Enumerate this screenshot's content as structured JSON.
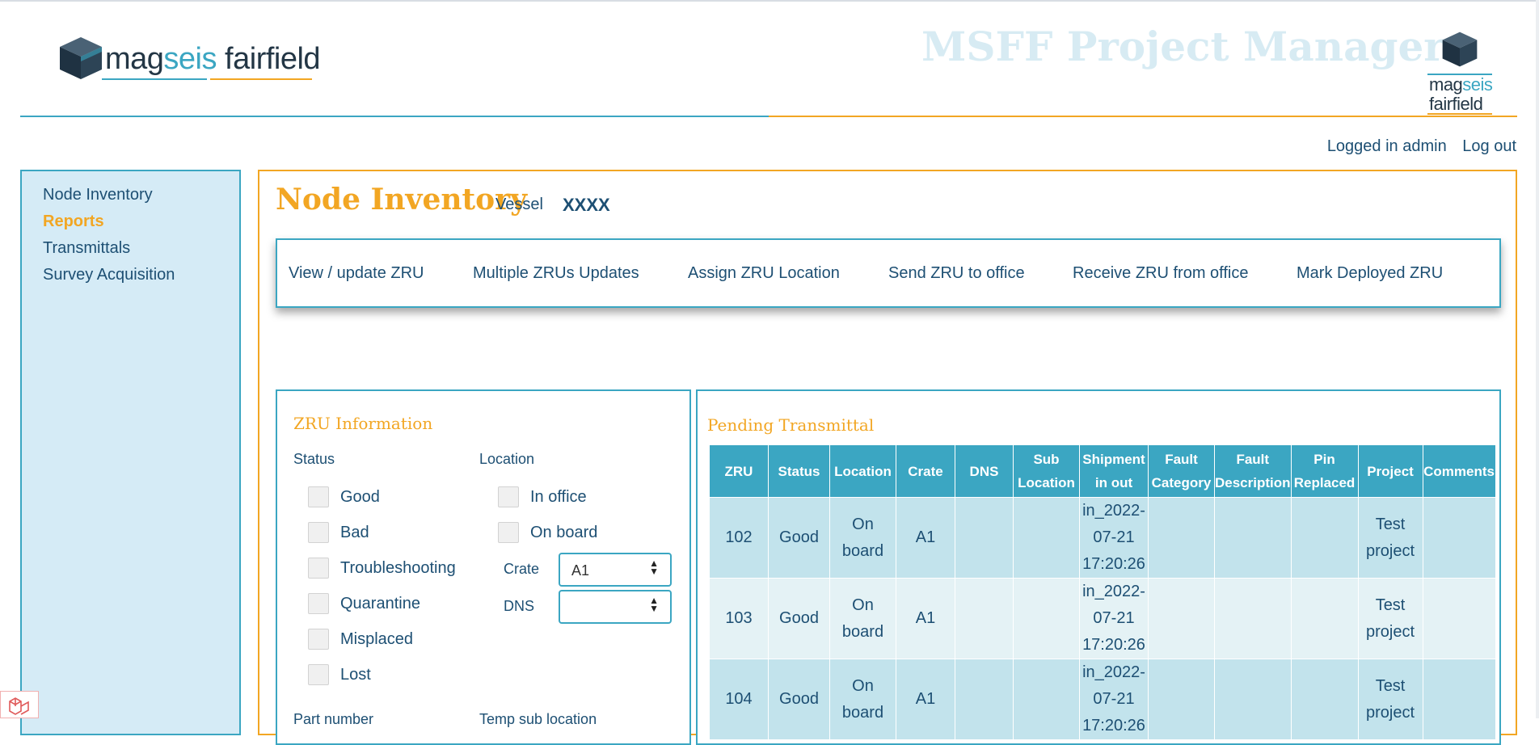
{
  "header": {
    "brand_left": {
      "mag": "mag",
      "seis": "seis",
      "fairfield": " fairfield"
    },
    "app_title": "MSFF Project Manager",
    "brand_right": {
      "mag": "mag",
      "seis": "seis",
      "fairfield": "fairfield"
    }
  },
  "auth": {
    "logged_in": "Logged in admin",
    "logout": "Log out"
  },
  "sidebar": {
    "items": [
      {
        "label": "Node Inventory",
        "active": false
      },
      {
        "label": "Reports",
        "active": true
      },
      {
        "label": "Transmittals",
        "active": false
      },
      {
        "label": "Survey Acquisition",
        "active": false
      }
    ]
  },
  "main": {
    "title": "Node Inventory",
    "vessel_label": "Vessel",
    "vessel_value": "XXXX",
    "actions": [
      "View / update ZRU",
      "Multiple ZRUs Updates",
      "Assign ZRU Location",
      "Send ZRU to office",
      "Receive ZRU from office",
      "Mark Deployed ZRU"
    ]
  },
  "zru_info": {
    "title": "ZRU Information",
    "status_label": "Status",
    "status_options": [
      "Good",
      "Bad",
      "Troubleshooting",
      "Quarantine",
      "Misplaced",
      "Lost"
    ],
    "location_label": "Location",
    "location_options": [
      "In office",
      "On board"
    ],
    "crate_label": "Crate",
    "crate_value": "A1",
    "dns_label": "DNS",
    "dns_value": "",
    "part_number_label": "Part number",
    "temp_sub_location_label": "Temp sub location"
  },
  "pending": {
    "title": "Pending Transmittal",
    "columns": [
      [
        "ZRU"
      ],
      [
        "Status"
      ],
      [
        "Location"
      ],
      [
        "Crate"
      ],
      [
        "DNS"
      ],
      [
        "Sub",
        "Location"
      ],
      [
        "Shipment",
        "in out"
      ],
      [
        "Fault",
        "Category"
      ],
      [
        "Fault",
        "Description"
      ],
      [
        "Pin",
        "Replaced"
      ],
      [
        "Project"
      ],
      [
        "Comments"
      ]
    ],
    "rows": [
      {
        "zru": "102",
        "status": "Good",
        "location": [
          "On",
          "board"
        ],
        "crate": "A1",
        "dns": "",
        "sub_location": "",
        "shipment": [
          "in_2022-",
          "07-21",
          "17:20:26"
        ],
        "fault_category": "",
        "fault_description": "",
        "pin_replaced": "",
        "project": [
          "Test",
          "project"
        ],
        "comments": ""
      },
      {
        "zru": "103",
        "status": "Good",
        "location": [
          "On",
          "board"
        ],
        "crate": "A1",
        "dns": "",
        "sub_location": "",
        "shipment": [
          "in_2022-",
          "07-21",
          "17:20:26"
        ],
        "fault_category": "",
        "fault_description": "",
        "pin_replaced": "",
        "project": [
          "Test",
          "project"
        ],
        "comments": ""
      },
      {
        "zru": "104",
        "status": "Good",
        "location": [
          "On",
          "board"
        ],
        "crate": "A1",
        "dns": "",
        "sub_location": "",
        "shipment": [
          "in_2022-",
          "07-21",
          "17:20:26"
        ],
        "fault_category": "",
        "fault_description": "",
        "pin_replaced": "",
        "project": [
          "Test",
          "project"
        ],
        "comments": ""
      }
    ]
  },
  "colors": {
    "accent_blue": "#3ba6c2",
    "accent_orange": "#f2a623",
    "text_navy": "#1d4f73",
    "sidebar_bg": "#d5ebf6"
  }
}
